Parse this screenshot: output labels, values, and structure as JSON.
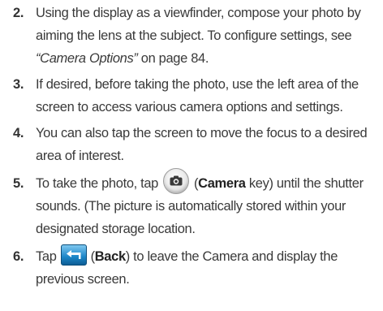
{
  "steps": [
    {
      "number": "2.",
      "text_a": "Using the display as a viewfinder, compose your photo by aiming the lens at the subject. To configure settings, see ",
      "ref": "“Camera Options”",
      "text_b": " on page 84."
    },
    {
      "number": "3.",
      "text": "If desired, before taking the photo, use the left area of the screen to access various camera options and settings."
    },
    {
      "number": "4.",
      "text": "You can also tap the screen to move the focus to a desired area of interest."
    },
    {
      "number": "5.",
      "text_a": "To take the photo, tap",
      "paren_open": "(",
      "bold": "Camera",
      "text_b": " key) until the shutter sounds. (The picture is automatically stored within your designated storage location."
    },
    {
      "number": "6.",
      "text_a": "Tap",
      "paren_open": "(",
      "bold": "Back",
      "text_b": ") to leave the Camera and display the previous screen."
    }
  ],
  "icons": [
    "camera-key-icon",
    "back-key-icon"
  ]
}
